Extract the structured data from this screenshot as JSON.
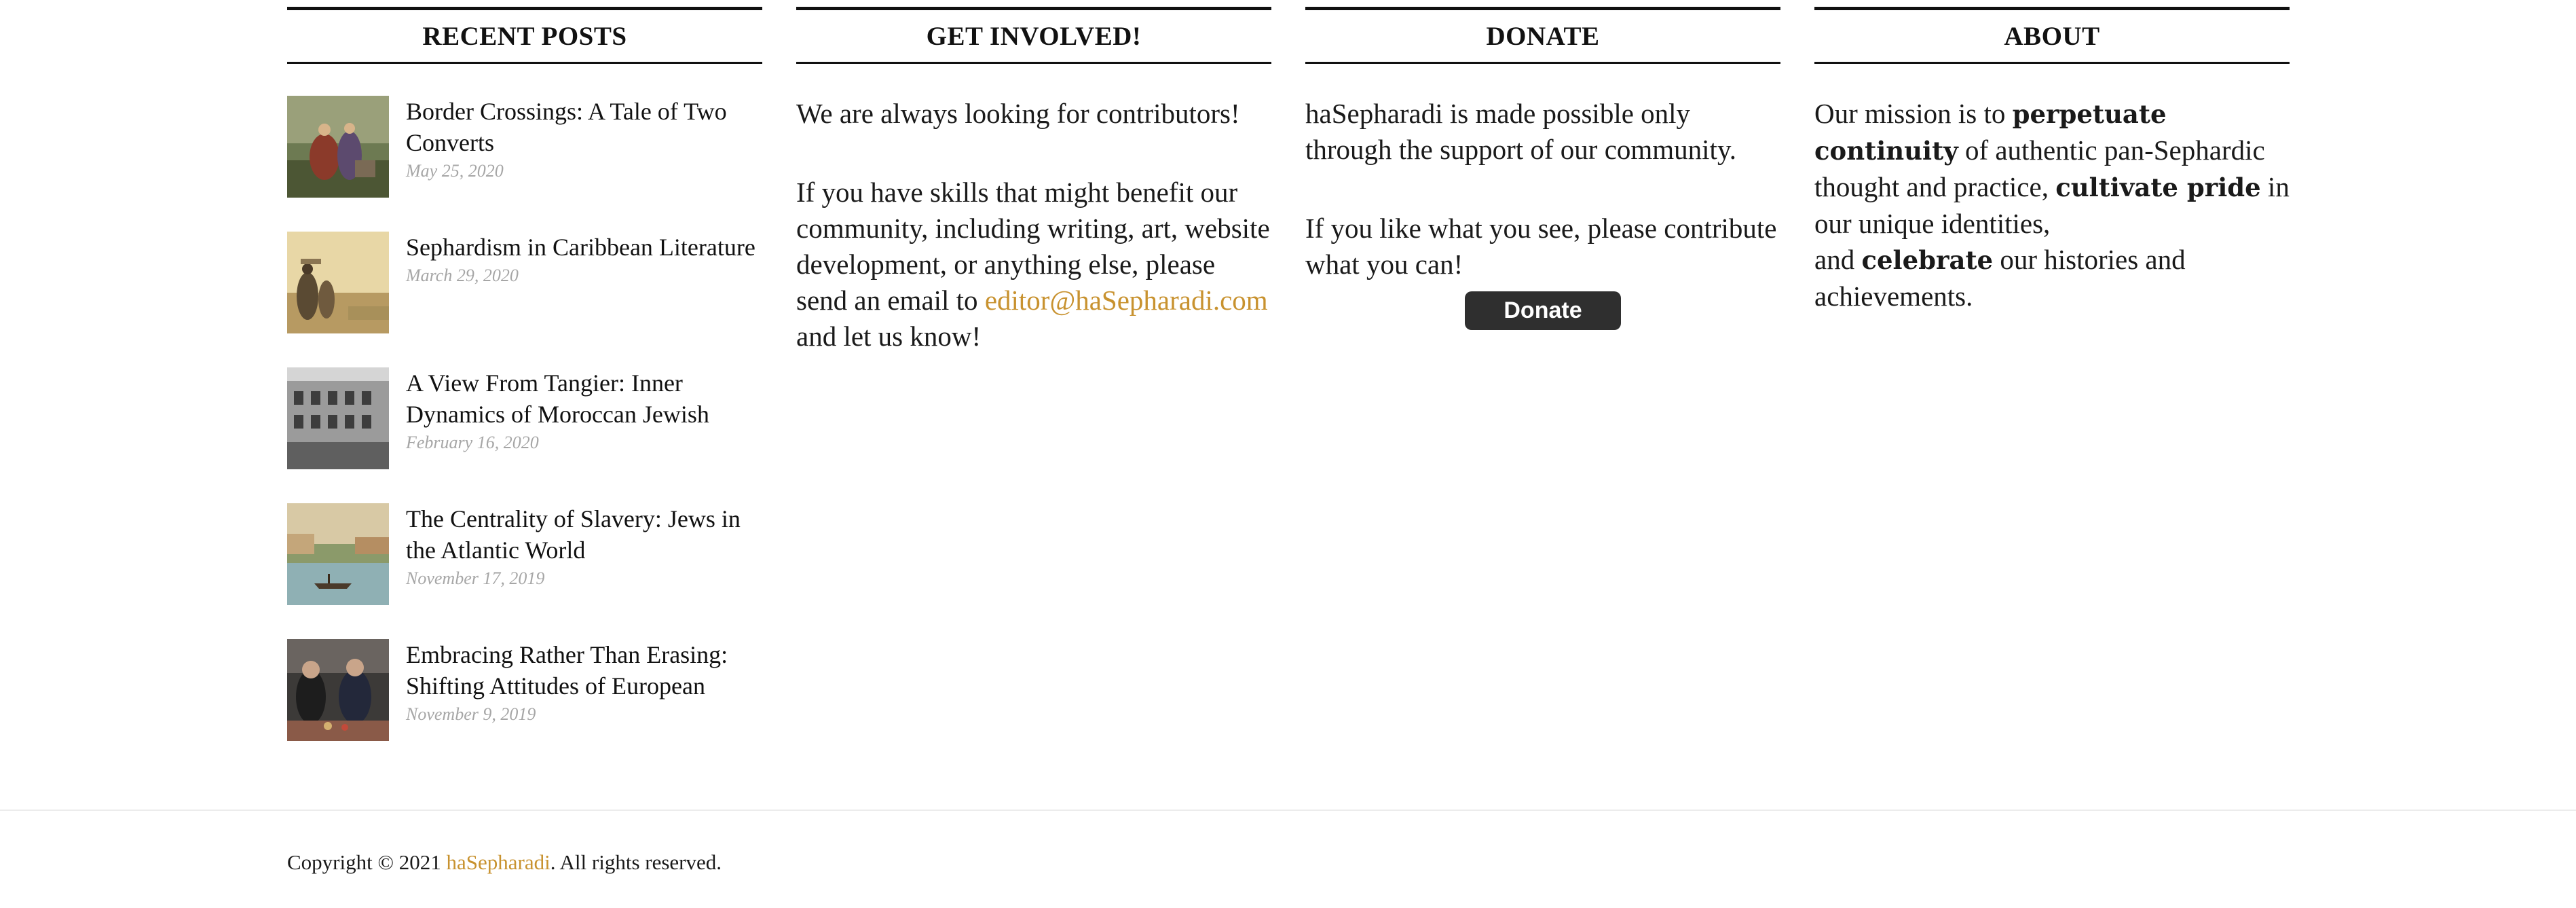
{
  "recent_posts": {
    "title": "RECENT POSTS",
    "items": [
      {
        "title": "Border Crossings: A Tale of Two Converts",
        "date": "May 25, 2020",
        "thumbnail": "painting-travelers-thumbnail"
      },
      {
        "title": "Sephardism in Caribbean Literature",
        "date": "March 29, 2020",
        "thumbnail": "painting-caribbean-figures-thumbnail"
      },
      {
        "title": "A View From Tangier: Inner Dynamics of Moroccan Jewish",
        "date": "February 16, 2020",
        "thumbnail": "photo-tangier-building-thumbnail"
      },
      {
        "title": "The Centrality of Slavery: Jews in the Atlantic World",
        "date": "November 17, 2019",
        "thumbnail": "painting-harbor-thumbnail"
      },
      {
        "title": "Embracing Rather Than Erasing: Shifting Attitudes of European",
        "date": "November 9, 2019",
        "thumbnail": "photo-gathering-thumbnail"
      }
    ]
  },
  "get_involved": {
    "title": "GET INVOLVED!",
    "paragraph1": "We are always looking for contributors!",
    "paragraph2_before": "If you have skills that might benefit our community, including writing, art, website development, or anything else, please send an email to ",
    "email_link": "editor@haSepharadi.com",
    "paragraph2_after": " and let us know!"
  },
  "donate": {
    "title": "DONATE",
    "paragraph1": "haSepharadi is made possible only through the support of our community.",
    "paragraph2": "If you like what you see, please contribute what you can!",
    "button_label": "Donate",
    "button_color": "#2f2f2f"
  },
  "about": {
    "title": "ABOUT",
    "part1": "Our mission is to ",
    "bold1": "perpetuate continuity",
    "part2": " of authentic pan-Sephardic thought and practice, ",
    "bold2": "cultivate pride",
    "part3": " in our unique identities,",
    "part4": "and ",
    "bold3": "celebrate",
    "part5": " our histories and achievements."
  },
  "footer": {
    "copyright_prefix": "Copyright © 2021 ",
    "site_link": "haSepharadi",
    "copyright_suffix": ". All rights reserved."
  },
  "colors": {
    "accent_link": "#c8922f",
    "date_text": "#a6a6a6",
    "rule": "#111111"
  }
}
